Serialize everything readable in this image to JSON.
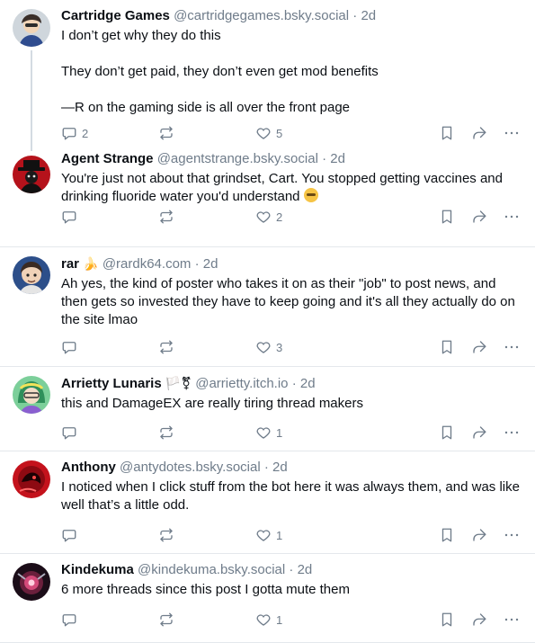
{
  "posts": [
    {
      "name": "Cartridge Games",
      "handle": "@cartridgegames.bsky.social",
      "time": "2d",
      "paragraphs": [
        "I don’t get why they do this",
        "They don’t get paid, they don’t even get mod benefits",
        "—R on the gaming side is all over the front page"
      ],
      "replies": "2",
      "reposts": "",
      "likes": "5"
    },
    {
      "name": "Agent Strange",
      "handle": "@agentstrange.bsky.social",
      "time": "2d",
      "text": "You're just not about that grindset, Cart. You stopped getting vaccines and drinking fluoride water you'd understand",
      "emoji": "face-emoji",
      "replies": "",
      "reposts": "",
      "likes": "2"
    },
    {
      "name": "rar",
      "name_icon": "🍌",
      "handle": "@rardk64.com",
      "time": "2d",
      "text": "Ah yes, the kind of poster who takes it on as their \"job\" to post news, and then gets so invested they have to keep going and it's all they actually do on the site lmao",
      "replies": "",
      "reposts": "",
      "likes": "3"
    },
    {
      "name": "Arrietty Lunaris",
      "name_icon": "🏳️⚧",
      "handle": "@arrietty.itch.io",
      "time": "2d",
      "text": "this and DamageEX are really tiring thread makers",
      "replies": "",
      "reposts": "",
      "likes": "1"
    },
    {
      "name": "Anthony",
      "handle": "@antydotes.bsky.social",
      "time": "2d",
      "text": "I noticed when I click stuff from the bot here it was always them, and was like well that’s a little odd.",
      "replies": "",
      "reposts": "",
      "likes": "1"
    },
    {
      "name": "Kindekuma",
      "handle": "@kindekuma.bsky.social",
      "time": "2d",
      "text": "6 more threads since this post I gotta mute them",
      "replies": "",
      "reposts": "",
      "likes": "1"
    }
  ],
  "separator": "·",
  "icons": [
    "reply-icon",
    "repost-icon",
    "like-icon",
    "bookmark-icon",
    "share-icon",
    "more-icon"
  ],
  "colors": {
    "text": "#0b0f14",
    "muted": "#6f7c8a",
    "divider": "#e4e8ec"
  }
}
